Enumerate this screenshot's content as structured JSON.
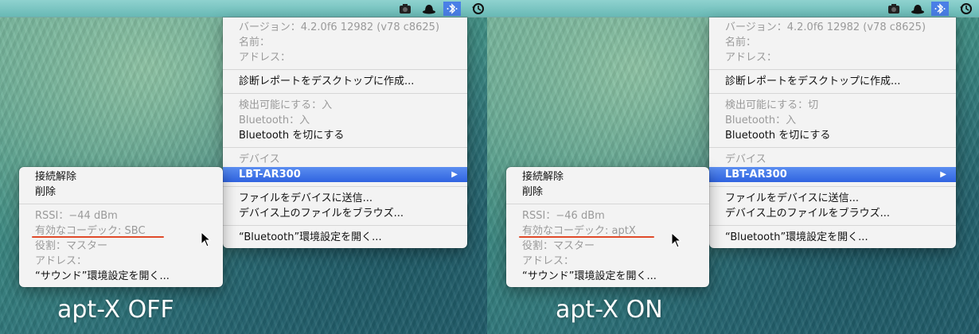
{
  "panels": [
    {
      "caption": "apt-X OFF",
      "bt_menu": {
        "version": "バージョン：4.2.0f6 12982 (v78 c8625)",
        "name": "名前：",
        "address": "アドレス：",
        "diag": "診断レポートをデスクトップに作成...",
        "discoverable": "検出可能にする：入",
        "bt_state": "Bluetooth：入",
        "bt_toggle": "Bluetooth を切にする",
        "devices_header": "デバイス",
        "device_name": "LBT-AR300",
        "send_file": "ファイルをデバイスに送信...",
        "browse": "デバイス上のファイルをブラウズ...",
        "open_prefs": "“Bluetooth”環境設定を開く..."
      },
      "submenu": {
        "disconnect": "接続解除",
        "remove": "削除",
        "rssi": "RSSI：−44 dBm",
        "codec": "有効なコーデック: SBC",
        "role": "役割：マスター",
        "address": "アドレス：",
        "open_sound": "“サウンド”環境設定を開く..."
      }
    },
    {
      "caption": "apt-X ON",
      "bt_menu": {
        "version": "バージョン：4.2.0f6 12982 (v78 c8625)",
        "name": "名前：",
        "address": "アドレス：",
        "diag": "診断レポートをデスクトップに作成...",
        "discoverable": "検出可能にする：切",
        "bt_state": "Bluetooth：入",
        "bt_toggle": "Bluetooth を切にする",
        "devices_header": "デバイス",
        "device_name": "LBT-AR300",
        "send_file": "ファイルをデバイスに送信...",
        "browse": "デバイス上のファイルをブラウズ...",
        "open_prefs": "“Bluetooth”環境設定を開く..."
      },
      "submenu": {
        "disconnect": "接続解除",
        "remove": "削除",
        "rssi": "RSSI：−46 dBm",
        "codec": "有効なコーデック: aptX",
        "role": "役割：マスター",
        "address": "アドレス：",
        "open_sound": "“サウンド”環境設定を開く..."
      }
    }
  ],
  "menubar_icons": [
    "camera-icon",
    "hat-icon",
    "bluetooth-icon",
    "time-machine-icon"
  ],
  "colors": {
    "selection": "#3a6fe4",
    "codec_underline": "#e04a2a"
  }
}
